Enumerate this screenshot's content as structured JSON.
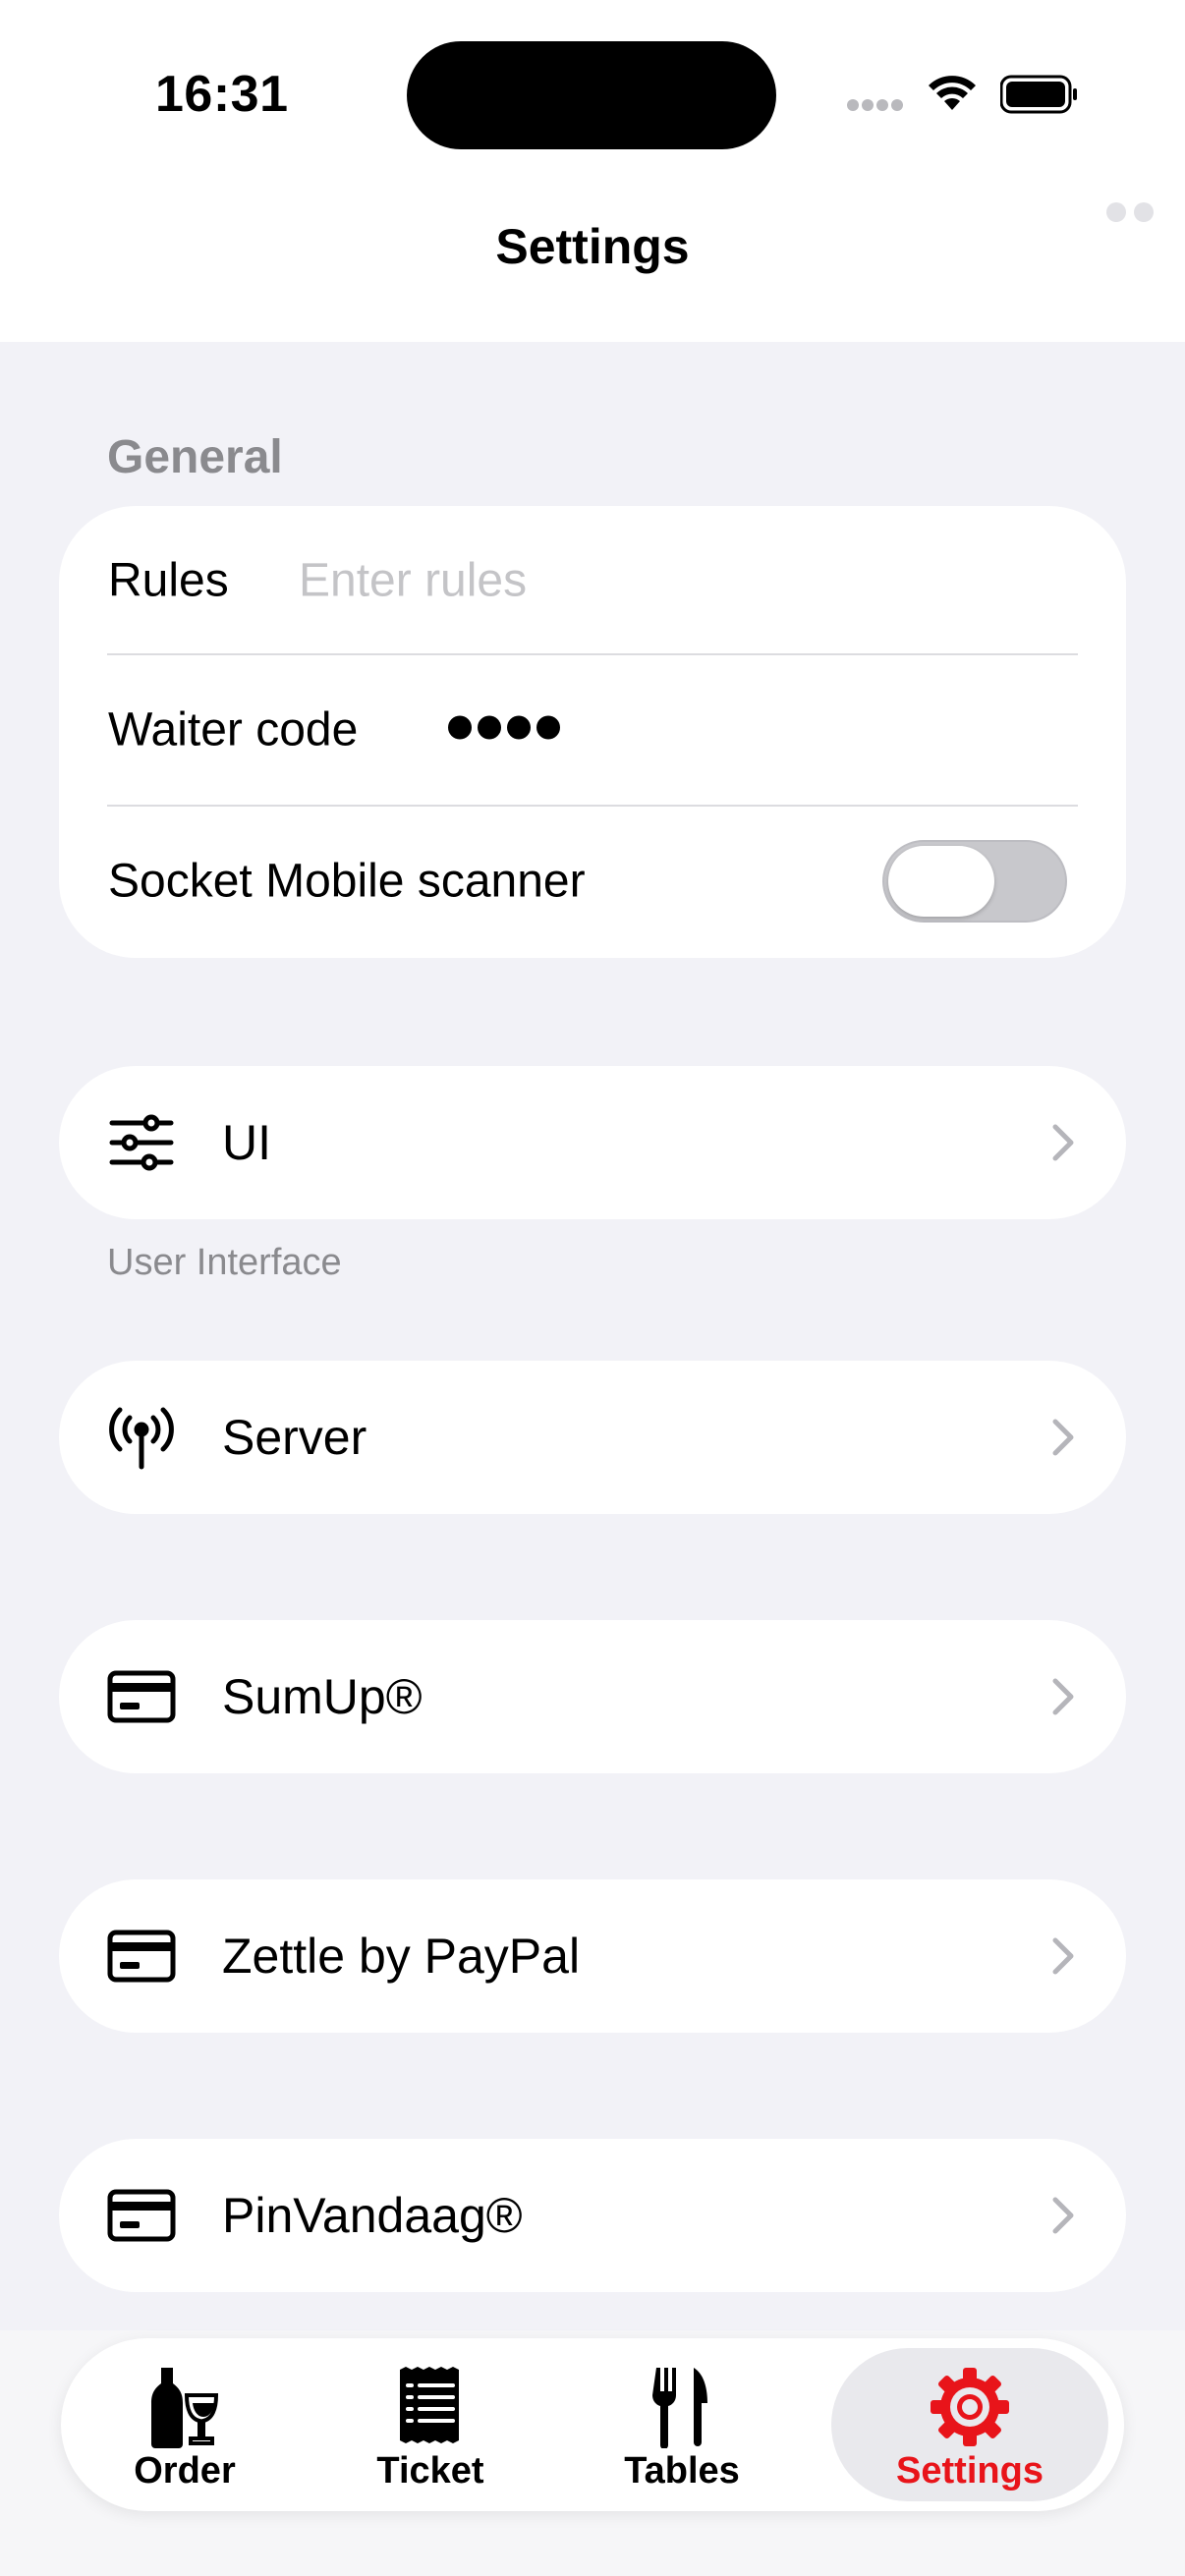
{
  "status_bar": {
    "time": "16:31"
  },
  "nav": {
    "title": "Settings"
  },
  "general": {
    "header": "General",
    "rules_label": "Rules",
    "rules_placeholder": "Enter rules",
    "rules_value": "",
    "waiter_code_label": "Waiter code",
    "waiter_code_masked_length": 4,
    "scanner_label": "Socket Mobile scanner",
    "scanner_enabled": false
  },
  "items": [
    {
      "label": "UI",
      "icon": "sliders-icon",
      "footer": "User Interface"
    },
    {
      "label": "Server",
      "icon": "antenna-icon"
    },
    {
      "label": "SumUp®",
      "icon": "credit-card-icon"
    },
    {
      "label": "Zettle by PayPal",
      "icon": "credit-card-icon"
    },
    {
      "label": "PinVandaag®",
      "icon": "credit-card-icon"
    }
  ],
  "tabs": [
    {
      "label": "Order",
      "icon": "wine-bottle-glass-icon",
      "active": false
    },
    {
      "label": "Ticket",
      "icon": "receipt-icon",
      "active": false
    },
    {
      "label": "Tables",
      "icon": "fork-knife-icon",
      "active": false
    },
    {
      "label": "Settings",
      "icon": "gear-icon",
      "active": true
    }
  ],
  "colors": {
    "accent": "#e8141a",
    "background": "#f2f2f7",
    "secondary_text": "#8a8a8e"
  }
}
